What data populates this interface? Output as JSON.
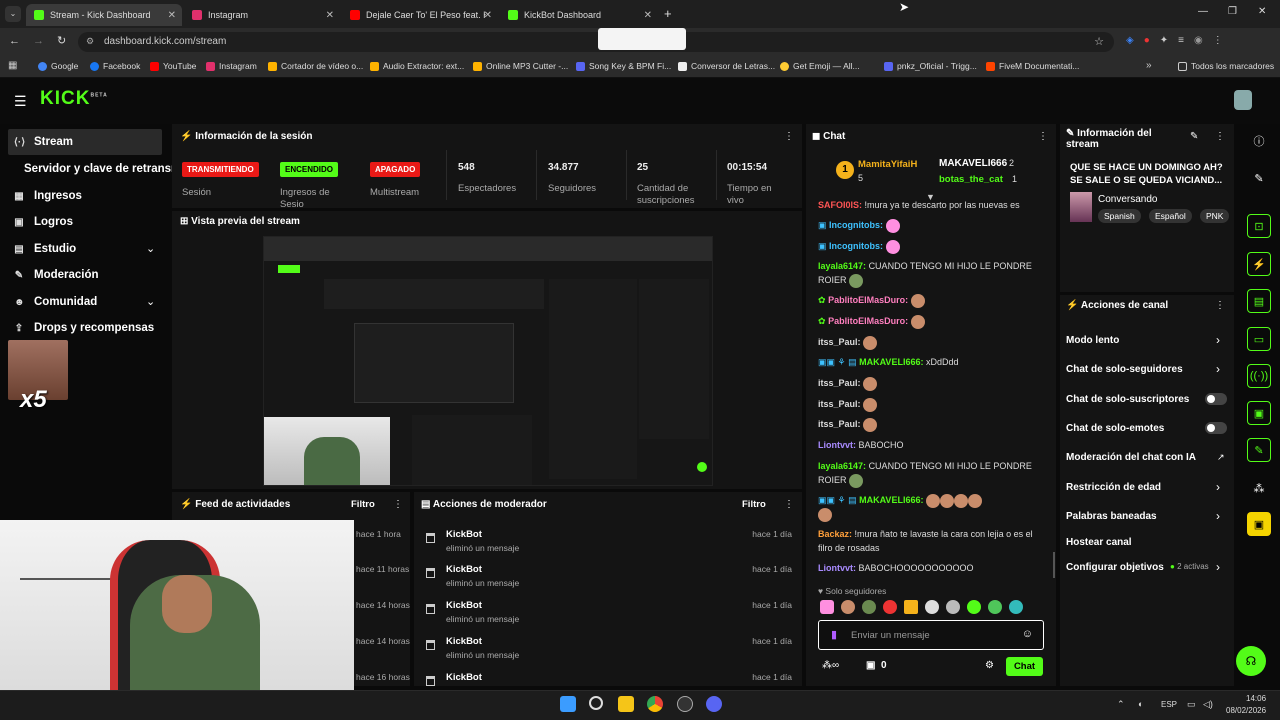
{
  "browser": {
    "tabs": [
      {
        "label": "Stream - Kick Dashboard",
        "color": "#53fc18"
      },
      {
        "label": "Instagram",
        "color": "#e1306c"
      },
      {
        "label": "Dejale Caer To' El Peso feat. He",
        "color": "#ff0000"
      },
      {
        "label": "KickBot Dashboard",
        "color": "#53fc18"
      }
    ],
    "url": "dashboard.kick.com/stream",
    "bookmarks": [
      "Google",
      "Facebook",
      "YouTube",
      "Instagram",
      "Cortador de vídeo o...",
      "Audio Extractor: ext...",
      "Online MP3 Cutter -...",
      "Song Key & BPM Fi...",
      "Conversor de Letras...",
      "Get Emoji — All...",
      "pnkz_Oficial - Trigg...",
      "FiveM Documentati..."
    ],
    "all_bookmarks": "Todos los marcadores"
  },
  "kick": {
    "logo": "KICK",
    "logo_sup": "BETA",
    "brand_color": "#53fc18"
  },
  "sidebar": {
    "items": [
      {
        "label": "Stream",
        "icon": "stream-icon"
      },
      {
        "label": "Servidor y clave de retransm",
        "icon": ""
      },
      {
        "label": "Ingresos",
        "icon": "revenue-icon"
      },
      {
        "label": "Logros",
        "icon": "achievements-icon"
      },
      {
        "label": "Estudio",
        "icon": "studio-icon"
      },
      {
        "label": "Moderación",
        "icon": "wrench-icon"
      },
      {
        "label": "Comunidad",
        "icon": "community-icon"
      },
      {
        "label": "Drops y recompensas",
        "icon": "drops-icon"
      }
    ],
    "overlay_text": "x5"
  },
  "session": {
    "title": "Información de la sesión",
    "badges": [
      "TRANSMITIENDO",
      "ENCENDIDO",
      "APAGADO"
    ],
    "badge_labels": [
      "Sesión",
      "Ingresos de Sesio",
      "Multistream"
    ],
    "stats": [
      {
        "value": "548",
        "label": "Espectadores"
      },
      {
        "value": "34.877",
        "label": "Seguidores"
      },
      {
        "value": "25",
        "label": "Cantidad de suscripciones"
      },
      {
        "value": "00:15:54",
        "label": "Tiempo en vivo"
      }
    ]
  },
  "preview": {
    "title": "Vista previa del stream"
  },
  "feed": {
    "title": "Feed de actividades",
    "filter": "Filtro",
    "times": [
      "hace 1 hora",
      "hace 11 horas",
      "hace 14 horas",
      "hace 14 horas",
      "hace 16 horas"
    ]
  },
  "modactions": {
    "title": "Acciones de moderador",
    "filter": "Filtro",
    "rows": [
      {
        "name": "KickBot",
        "action": "eliminó un mensaje",
        "time": "hace 1 día"
      },
      {
        "name": "KickBot",
        "action": "eliminó un mensaje",
        "time": "hace 1 día"
      },
      {
        "name": "KickBot",
        "action": "eliminó un mensaje",
        "time": "hace 1 día"
      },
      {
        "name": "KickBot",
        "action": "eliminó un mensaje",
        "time": "hace 1 día"
      },
      {
        "name": "KickBot",
        "action": "",
        "time": "hace 1 día"
      }
    ]
  },
  "chat": {
    "title": "Chat",
    "pinned": [
      {
        "rank": "1",
        "name": "MamitaYifaiH",
        "count": "5"
      },
      {
        "rank": "",
        "name": "MAKAVELI666",
        "count": "2"
      },
      {
        "rank": "",
        "name": "botas_the_cat",
        "count": "1"
      }
    ],
    "messages": [
      {
        "user": "SAFOI0IS:",
        "color": "#ff5555",
        "text": "!mura ya te descarto por las nuevas es"
      },
      {
        "user": "Incognitobs:",
        "color": "#3ec2ff",
        "text": ""
      },
      {
        "user": "Incognitobs:",
        "color": "#3ec2ff",
        "text": ""
      },
      {
        "user": "layala6147:",
        "color": "#53fc18",
        "text": "CUANDO TENGO MI HIJO LE PONDRE ROIER"
      },
      {
        "user": "PablitoElMasDuro:",
        "color": "#ff7fbf",
        "text": ""
      },
      {
        "user": "PablitoElMasDuro:",
        "color": "#ff7fbf",
        "text": ""
      },
      {
        "user": "itss_Paul:",
        "color": "#ffffff",
        "text": ""
      },
      {
        "user": "MAKAVELI666:",
        "color": "#53fc18",
        "text": "xDdDdd"
      },
      {
        "user": "itss_Paul:",
        "color": "#ffffff",
        "text": ""
      },
      {
        "user": "itss_Paul:",
        "color": "#ffffff",
        "text": ""
      },
      {
        "user": "itss_Paul:",
        "color": "#ffffff",
        "text": ""
      },
      {
        "user": "Liontvvt:",
        "color": "#a98bff",
        "text": "BABOCHO"
      },
      {
        "user": "layala6147:",
        "color": "#53fc18",
        "text": "CUANDO TENGO MI HIJO LE PONDRE ROIER"
      },
      {
        "user": "MAKAVELI666:",
        "color": "#53fc18",
        "text": ""
      },
      {
        "user": "Backaz:",
        "color": "#ff9f3a",
        "text": "!mura ñato te lavaste la cara con lejia o es el filro de rosadas"
      },
      {
        "user": "Liontvvt:",
        "color": "#a98bff",
        "text": "BABOCHOOOOOOOOOOO"
      }
    ],
    "followers_only": "Solo seguidores",
    "input_placeholder": "Enviar un mensaje",
    "points": "0",
    "send_label": "Chat"
  },
  "streaminfo": {
    "title": "Información del stream",
    "stream_title": "QUE SE HACE UN DOMINGO AH? SE SALE O SE QUEDA VICIAND...",
    "category": "Conversando",
    "tags": [
      "Spanish",
      "Español",
      "PNK"
    ]
  },
  "channel": {
    "title": "Acciones de canal",
    "actions": [
      {
        "label": "Modo lento",
        "control": "chevron"
      },
      {
        "label": "Chat de solo-seguidores",
        "control": "chevron"
      },
      {
        "label": "Chat de solo-suscriptores",
        "control": "toggle"
      },
      {
        "label": "Chat de solo-emotes",
        "control": "toggle"
      },
      {
        "label": "Moderación del chat con IA",
        "control": "external"
      },
      {
        "label": "Restricción de edad",
        "control": "chevron"
      },
      {
        "label": "Palabras baneadas",
        "control": "chevron"
      },
      {
        "label": "Hostear canal",
        "control": "none"
      },
      {
        "label": "Configurar objetivos",
        "control": "chevron"
      }
    ],
    "goals_badge": "2 activas"
  },
  "taskbar": {
    "lang": "ESP",
    "time": "14:06",
    "date": "08/02/2026"
  }
}
